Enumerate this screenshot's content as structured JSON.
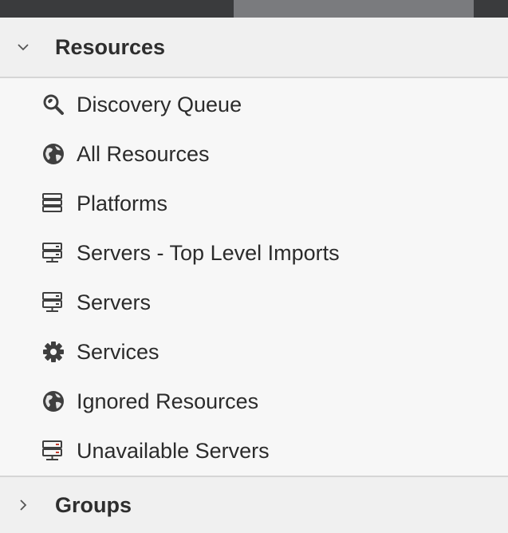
{
  "sections": {
    "resources": {
      "label": "Resources",
      "expanded": true,
      "items": [
        {
          "label": "Discovery Queue",
          "icon": "discovery-queue-icon"
        },
        {
          "label": "All Resources",
          "icon": "globe-icon"
        },
        {
          "label": "Platforms",
          "icon": "platforms-icon"
        },
        {
          "label": "Servers - Top Level Imports",
          "icon": "server-icon"
        },
        {
          "label": "Servers",
          "icon": "server-icon"
        },
        {
          "label": "Services",
          "icon": "gear-icon"
        },
        {
          "label": "Ignored Resources",
          "icon": "globe-icon"
        },
        {
          "label": "Unavailable Servers",
          "icon": "server-unavailable-icon"
        }
      ]
    },
    "groups": {
      "label": "Groups",
      "expanded": false
    }
  },
  "colors": {
    "background": "#f7f7f7",
    "header_background": "#f0f0f0",
    "unavailable_accent": "#c0392b"
  }
}
